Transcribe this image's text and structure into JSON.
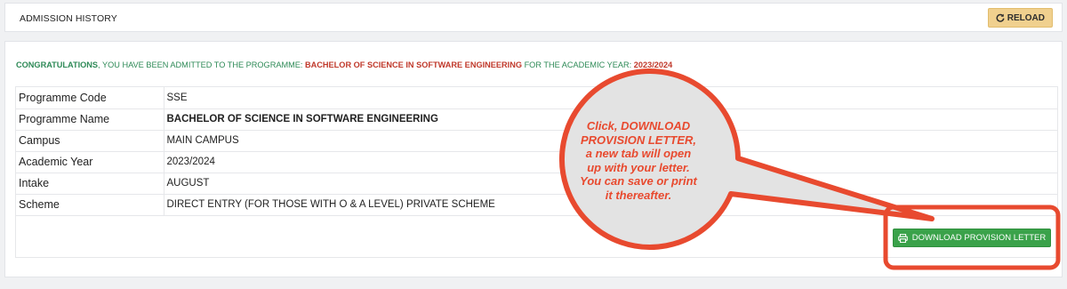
{
  "header": {
    "title": "ADMISSION HISTORY",
    "reload_label": "RELOAD"
  },
  "congrats": {
    "lead": "CONGRATULATIONS",
    "middle": ", YOU HAVE BEEN ADMITTED TO THE PROGRAMME: ",
    "programme": "BACHELOR OF SCIENCE IN SOFTWARE ENGINEERING",
    "for_text": " FOR THE ACADEMIC YEAR: ",
    "year": "2023/2024"
  },
  "details": {
    "rows": [
      {
        "label": "Programme Code",
        "value": "SSE"
      },
      {
        "label": "Programme Name",
        "value": "BACHELOR OF SCIENCE IN SOFTWARE ENGINEERING"
      },
      {
        "label": "Campus",
        "value": "MAIN CAMPUS"
      },
      {
        "label": "Academic Year",
        "value": "2023/2024"
      },
      {
        "label": "Intake",
        "value": "AUGUST"
      },
      {
        "label": "Scheme",
        "value": "DIRECT ENTRY (FOR THOSE WITH O & A LEVEL) PRIVATE SCHEME"
      }
    ]
  },
  "download": {
    "label": "DOWNLOAD PROVISION LETTER"
  },
  "callout": {
    "lines": [
      "Click, DOWNLOAD",
      "PROVISION LETTER,",
      "a new tab will open",
      "up with your letter.",
      "You can save or print",
      "it thereafter."
    ]
  },
  "colors": {
    "accent_green": "#3aa24a",
    "congrats_green": "#2e8a57",
    "highlight_red": "#c0392b",
    "annotation_red": "#e84a2f",
    "reload_yellow": "#f0d08e"
  },
  "icons": {
    "reload": "refresh-icon",
    "download": "print-icon"
  }
}
